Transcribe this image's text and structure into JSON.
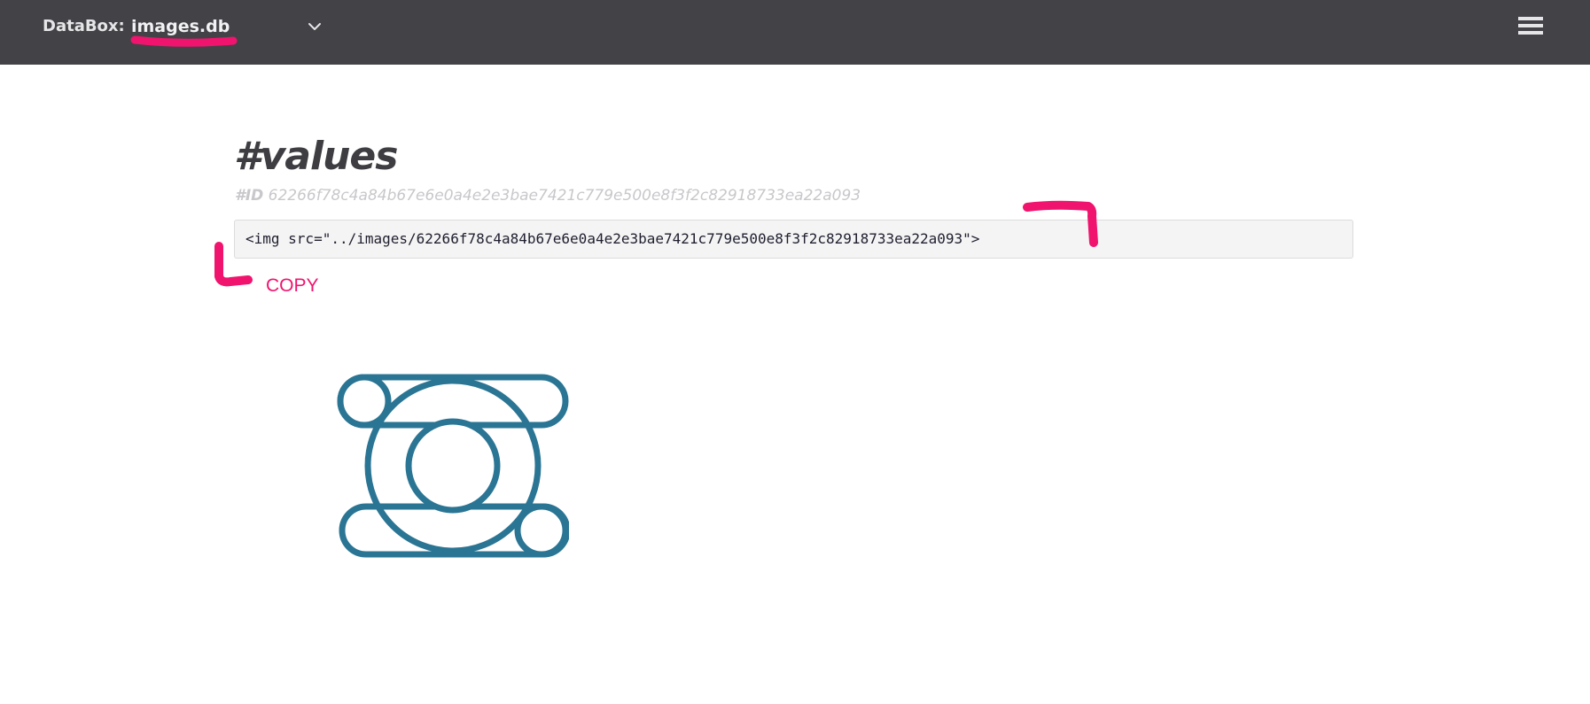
{
  "header": {
    "brand": "DataBox:",
    "database_name": "images.db",
    "colors": {
      "bar": "#434247",
      "highlight": "#f0146e"
    }
  },
  "main": {
    "title": "#values",
    "id_label": "#ID",
    "id_value": "62266f78c4a84b67e6e0a4e2e3bae7421c779e500e8f3f2c82918733ea22a093",
    "code_snippet": "<img src=\"../images/62266f78c4a84b67e6e0a4e2e3bae7421c779e500e8f3f2c82918733ea22a093\">",
    "copy_label": "COPY"
  },
  "icons": {
    "dropdown": "chevron-down-icon",
    "menu": "hamburger-menu-icon",
    "preview": "image-preview"
  },
  "preview_color": "#2b7594"
}
